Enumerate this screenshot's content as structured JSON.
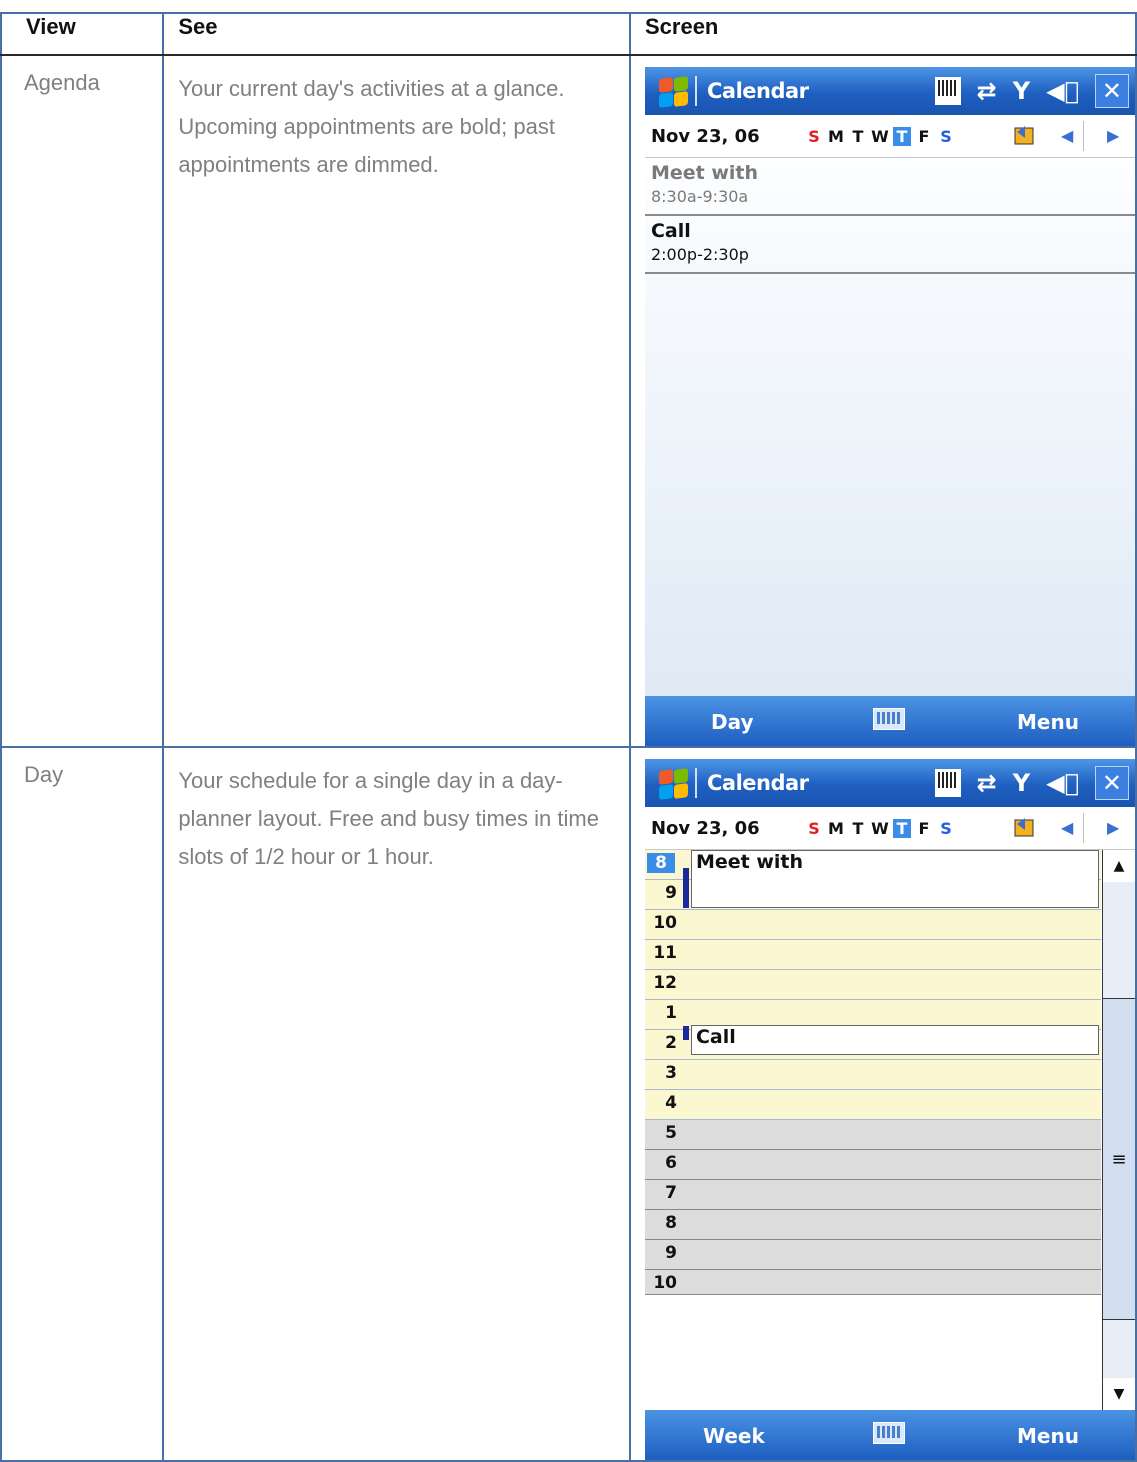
{
  "table": {
    "headers": {
      "view": "View",
      "see": "See",
      "screen": "Screen"
    },
    "rows": [
      {
        "view": "Agenda",
        "see": "Your current day's activities at a glance. Upcoming appointments are bold; past appointments are dimmed."
      },
      {
        "view": "Day",
        "see": "Your schedule for a single day in a day-planner layout. Free and busy times in time slots of 1/2 hour or 1 hour."
      }
    ]
  },
  "screens": {
    "app_title": "Calendar",
    "date": "Nov 23, 06",
    "weekdays": [
      "S",
      "M",
      "T",
      "W",
      "T",
      "F",
      "S"
    ],
    "today_index": 4,
    "agenda": {
      "appointments": [
        {
          "title": "Meet with",
          "time": "8:30a-9:30a",
          "state": "past"
        },
        {
          "title": "Call",
          "time": "2:00p-2:30p",
          "state": "upcoming"
        }
      ],
      "softkeys": {
        "left": "Day",
        "right": "Menu"
      }
    },
    "day": {
      "hours": [
        "8",
        "9",
        "10",
        "11",
        "12",
        "1",
        "2",
        "3",
        "4",
        "5",
        "6",
        "7",
        "8",
        "9",
        "10"
      ],
      "events": [
        {
          "title": "Meet with"
        },
        {
          "title": "Call"
        }
      ],
      "softkeys": {
        "left": "Week",
        "right": "Menu"
      }
    },
    "icons": [
      "windows-logo-icon",
      "input-panel-icon",
      "connectivity-icon",
      "signal-icon",
      "volume-icon",
      "close-icon",
      "go-to-today-icon",
      "keyboard-icon"
    ]
  }
}
